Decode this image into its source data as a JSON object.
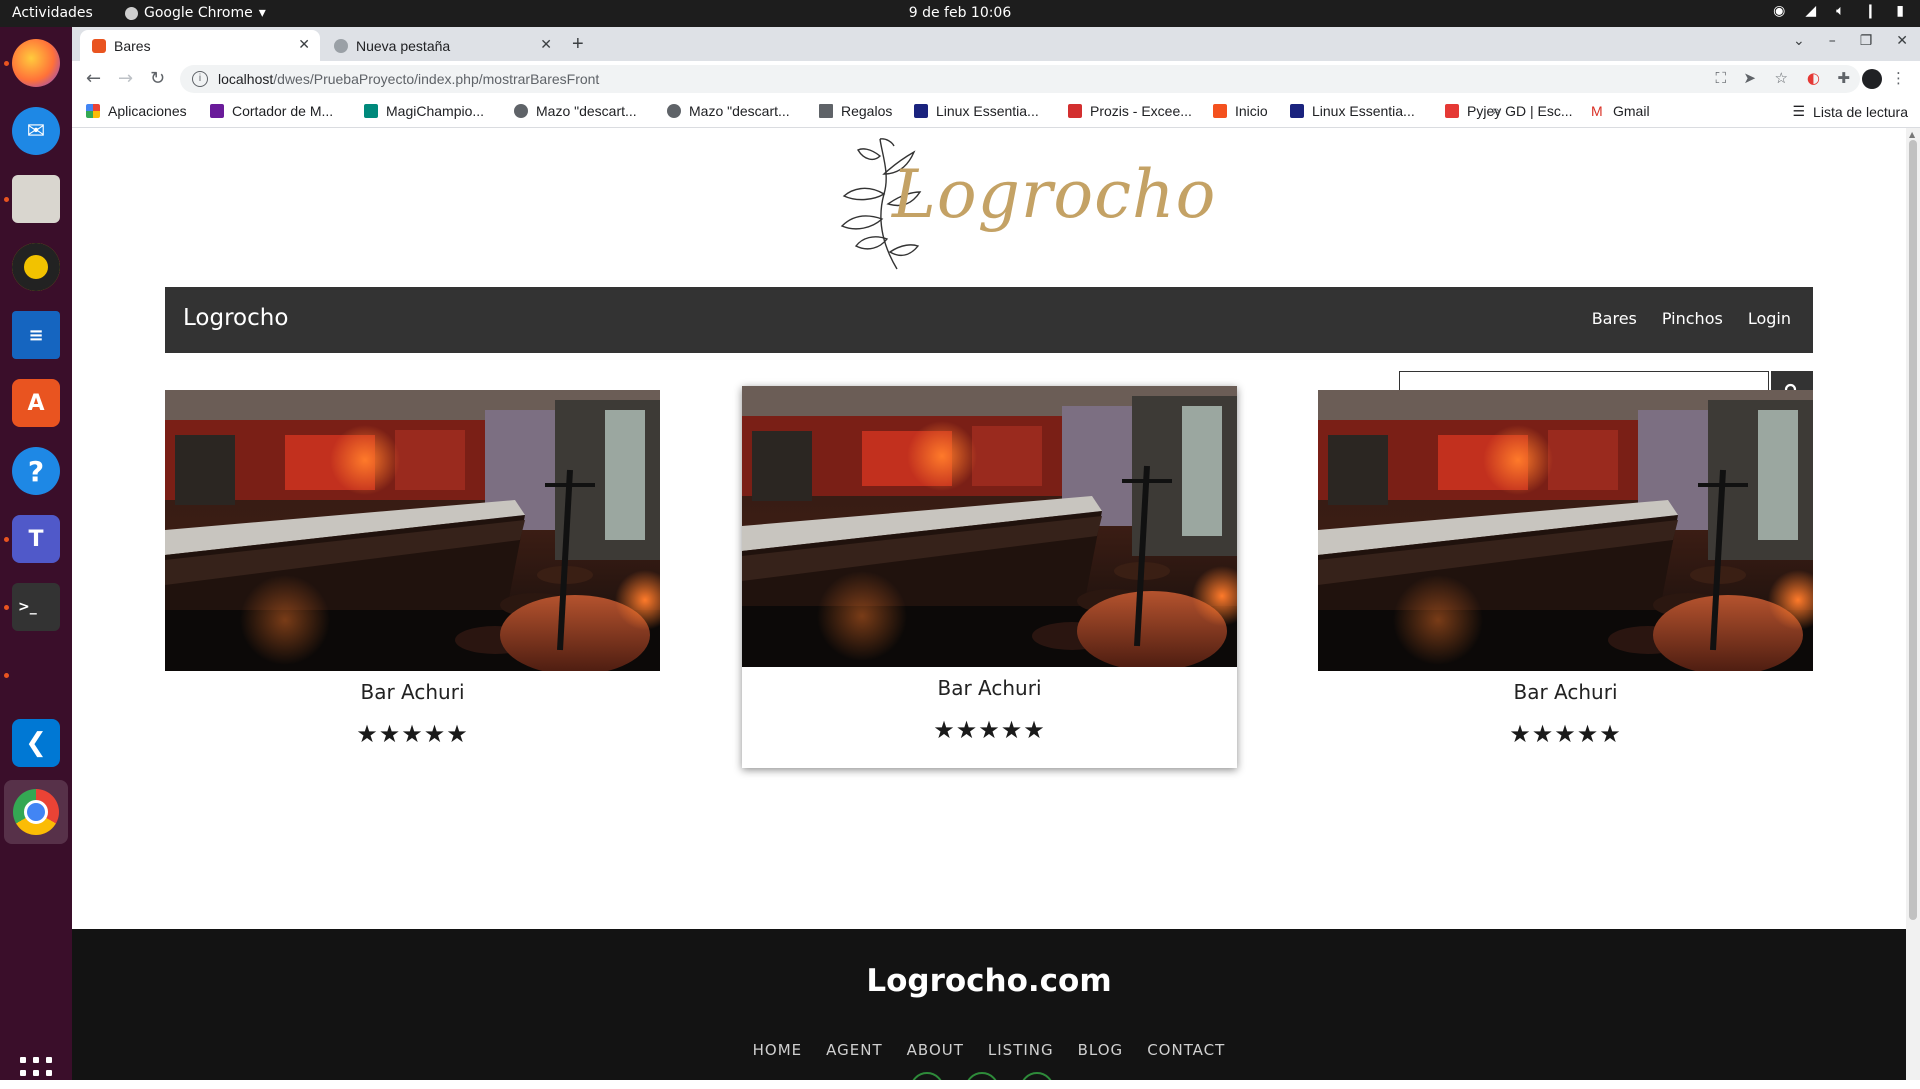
{
  "os": {
    "activities": "Actividades",
    "app_menu": "Google Chrome",
    "clock": "9 de feb  10:06"
  },
  "browser": {
    "tabs": [
      {
        "label": "Bares",
        "active": true
      },
      {
        "label": "Nueva pestaña",
        "active": false
      }
    ],
    "url_host": "localhost",
    "url_path": "/dwes/PruebaProyecto/index.php/mostrarBaresFront",
    "bookmarks": [
      {
        "label": "Aplicaciones",
        "color": "#ea4335"
      },
      {
        "label": "Cortador de M...",
        "color": "#6a1b9a"
      },
      {
        "label": "MagiChampio...",
        "color": "#00897b"
      },
      {
        "label": "Mazo \"descart...",
        "color": "#5f6368"
      },
      {
        "label": "Mazo \"descart...",
        "color": "#5f6368"
      },
      {
        "label": "Regalos",
        "color": "#5f6368"
      },
      {
        "label": "Linux Essentia...",
        "color": "#1a237e"
      },
      {
        "label": "Prozis - Excee...",
        "color": "#d32f2f"
      },
      {
        "label": "Inicio",
        "color": "#f4511e"
      },
      {
        "label": "Linux Essentia...",
        "color": "#1a237e"
      },
      {
        "label": "Pyjey GD | Esc...",
        "color": "#e53935"
      },
      {
        "label": "Gmail",
        "color": "#d93025"
      }
    ],
    "bookmarks_more": "»",
    "reading_list": "Lista de lectura"
  },
  "site": {
    "logo_text": "Logrocho",
    "nav_brand": "Logrocho",
    "nav_links": [
      "Bares",
      "Pinchos",
      "Login"
    ],
    "search_placeholder": "",
    "cards": [
      {
        "name": "Bar Achuri",
        "rating": 5,
        "stars": "★★★★★"
      },
      {
        "name": "Bar Achuri",
        "rating": 5,
        "stars": "★★★★★"
      },
      {
        "name": "Bar Achuri",
        "rating": 5,
        "stars": "★★★★★"
      }
    ],
    "footer_title": "Logrocho.com",
    "footer_menu": [
      "HOME",
      "AGENT",
      "ABOUT",
      "LISTING",
      "BLOG",
      "CONTACT"
    ]
  },
  "colors": {
    "accent_gold": "#c4a265",
    "nav_bg": "#333333",
    "footer_bg": "#131313"
  }
}
